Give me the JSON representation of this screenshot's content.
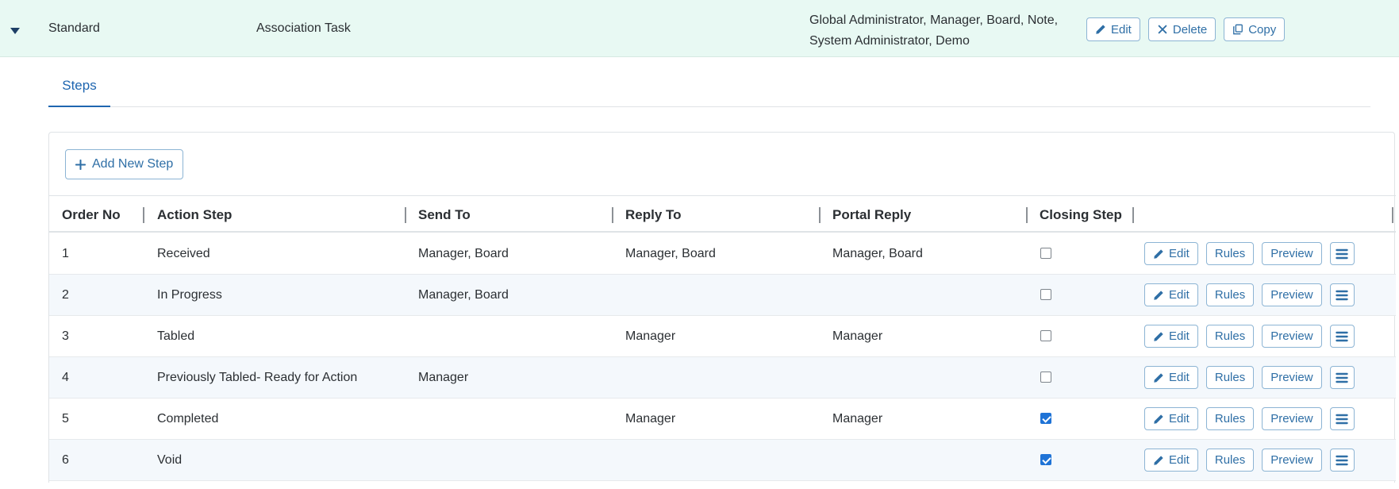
{
  "workflow": {
    "type": "Standard",
    "name": "Association Task",
    "roles": "Global Administrator, Manager, Board, Note, System Administrator, Demo",
    "actions": {
      "edit": "Edit",
      "delete": "Delete",
      "copy": "Copy"
    }
  },
  "tabs": [
    {
      "label": "Steps",
      "active": true
    }
  ],
  "steps_panel": {
    "add_label": "Add New Step",
    "columns": [
      "Order No",
      "Action Step",
      "Send To",
      "Reply To",
      "Portal Reply",
      "Closing Step"
    ],
    "row_actions": {
      "edit": "Edit",
      "rules": "Rules",
      "preview": "Preview"
    },
    "rows": [
      {
        "order": "1",
        "action": "Received",
        "send_to": "Manager, Board",
        "reply_to": "Manager, Board",
        "portal_reply": "Manager, Board",
        "closing": false
      },
      {
        "order": "2",
        "action": "In Progress",
        "send_to": "Manager, Board",
        "reply_to": "",
        "portal_reply": "",
        "closing": false
      },
      {
        "order": "3",
        "action": "Tabled",
        "send_to": "",
        "reply_to": "Manager",
        "portal_reply": "Manager",
        "closing": false
      },
      {
        "order": "4",
        "action": "Previously Tabled- Ready for Action",
        "send_to": "Manager",
        "reply_to": "",
        "portal_reply": "",
        "closing": false
      },
      {
        "order": "5",
        "action": "Completed",
        "send_to": "",
        "reply_to": "Manager",
        "portal_reply": "Manager",
        "closing": true
      },
      {
        "order": "6",
        "action": "Void",
        "send_to": "",
        "reply_to": "",
        "portal_reply": "",
        "closing": true
      }
    ]
  },
  "colors": {
    "accent": "#1f66b0",
    "header_bg": "#e8f9f3",
    "row_alt_bg": "#f4f8fc",
    "checkbox_on": "#1f73d6"
  },
  "icons": {
    "collapse": "caret-down-icon",
    "edit": "pencil-icon",
    "delete": "x-icon",
    "copy": "copy-icon",
    "add": "plus-icon",
    "menu": "hamburger-menu-icon"
  }
}
